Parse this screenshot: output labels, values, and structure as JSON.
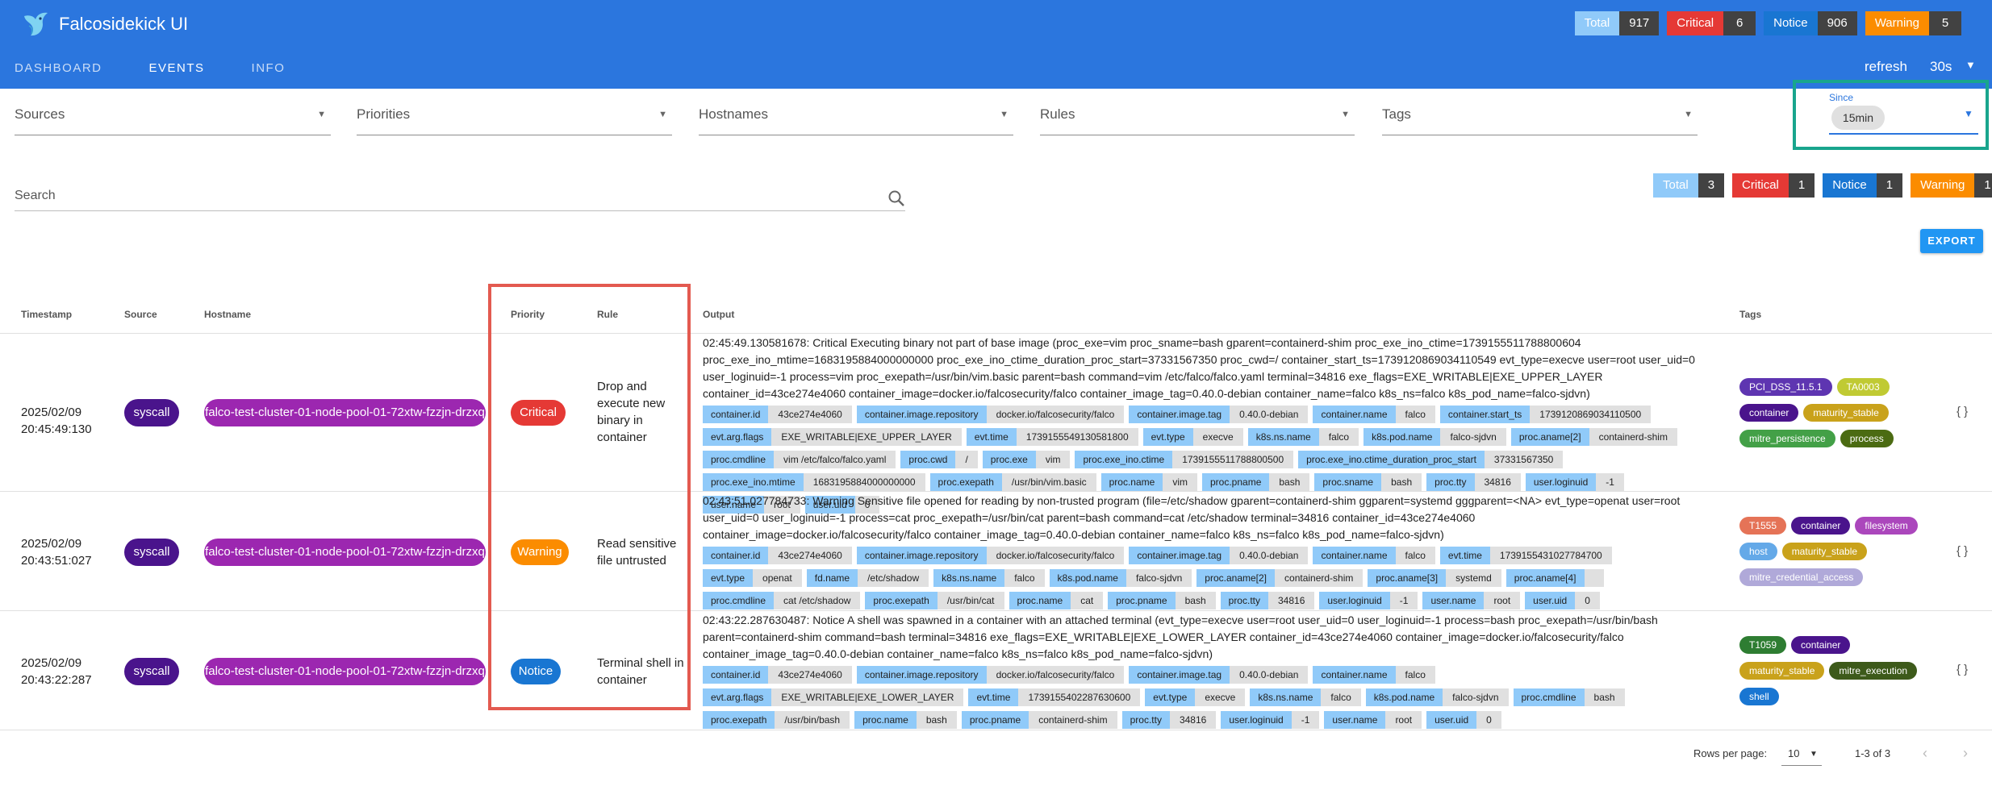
{
  "app": {
    "title": "Falcosidekick UI"
  },
  "header_counts": [
    {
      "label": "Total",
      "count": "917",
      "color": "#90caf9"
    },
    {
      "label": "Critical",
      "count": "6",
      "color": "#e53935"
    },
    {
      "label": "Notice",
      "count": "906",
      "color": "#1976d2"
    },
    {
      "label": "Warning",
      "count": "5",
      "color": "#fb8c00"
    }
  ],
  "nav": {
    "dashboard": "DASHBOARD",
    "events": "EVENTS",
    "info": "INFO"
  },
  "refresh": {
    "label": "refresh",
    "value": "30s"
  },
  "filters": {
    "sources": "Sources",
    "priorities": "Priorities",
    "hostnames": "Hostnames",
    "rules": "Rules",
    "tags": "Tags"
  },
  "since": {
    "label": "Since",
    "value": "15min"
  },
  "search": {
    "placeholder": "Search"
  },
  "summary_counts": [
    {
      "label": "Total",
      "count": "3",
      "color": "#90caf9"
    },
    {
      "label": "Critical",
      "count": "1",
      "color": "#e53935"
    },
    {
      "label": "Notice",
      "count": "1",
      "color": "#1976d2"
    },
    {
      "label": "Warning",
      "count": "1",
      "color": "#fb8c00"
    }
  ],
  "export_label": "EXPORT",
  "columns": {
    "timestamp": "Timestamp",
    "source": "Source",
    "hostname": "Hostname",
    "priority": "Priority",
    "rule": "Rule",
    "output": "Output",
    "tags": "Tags"
  },
  "events": [
    {
      "date": "2025/02/09",
      "time": "20:45:49:130",
      "source": "syscall",
      "hostname": "falco-test-cluster-01-node-pool-01-72xtw-fzzjn-drzxq",
      "priority": "Critical",
      "priority_color": "#e53935",
      "rule": "Drop and execute new binary in container",
      "output": "02:45:49.130581678: Critical Executing binary not part of base image (proc_exe=vim proc_sname=bash gparent=containerd-shim proc_exe_ino_ctime=1739155511788800604 proc_exe_ino_mtime=1683195884000000000 proc_exe_ino_ctime_duration_proc_start=37331567350 proc_cwd=/ container_start_ts=1739120869034110549 evt_type=execve user=root user_uid=0 user_loginuid=-1 process=vim proc_exepath=/usr/bin/vim.basic parent=bash command=vim /etc/falco/falco.yaml terminal=34816 exe_flags=EXE_WRITABLE|EXE_UPPER_LAYER container_id=43ce274e4060 container_image=docker.io/falcosecurity/falco container_image_tag=0.40.0-debian container_name=falco k8s_ns=falco k8s_pod_name=falco-sjdvn)",
      "fields": [
        {
          "k": "container.id",
          "v": "43ce274e4060"
        },
        {
          "k": "container.image.repository",
          "v": "docker.io/falcosecurity/falco"
        },
        {
          "k": "container.image.tag",
          "v": "0.40.0-debian"
        },
        {
          "k": "container.name",
          "v": "falco"
        },
        {
          "k": "container.start_ts",
          "v": "1739120869034110500"
        },
        {
          "k": "evt.arg.flags",
          "v": "EXE_WRITABLE|EXE_UPPER_LAYER"
        },
        {
          "k": "evt.time",
          "v": "1739155549130581800"
        },
        {
          "k": "evt.type",
          "v": "execve"
        },
        {
          "k": "k8s.ns.name",
          "v": "falco"
        },
        {
          "k": "k8s.pod.name",
          "v": "falco-sjdvn"
        },
        {
          "k": "proc.aname[2]",
          "v": "containerd-shim"
        },
        {
          "k": "proc.cmdline",
          "v": "vim /etc/falco/falco.yaml"
        },
        {
          "k": "proc.cwd",
          "v": "/"
        },
        {
          "k": "proc.exe",
          "v": "vim"
        },
        {
          "k": "proc.exe_ino.ctime",
          "v": "1739155511788800500"
        },
        {
          "k": "proc.exe_ino.ctime_duration_proc_start",
          "v": "37331567350"
        },
        {
          "k": "proc.exe_ino.mtime",
          "v": "1683195884000000000"
        },
        {
          "k": "proc.exepath",
          "v": "/usr/bin/vim.basic"
        },
        {
          "k": "proc.name",
          "v": "vim"
        },
        {
          "k": "proc.pname",
          "v": "bash"
        },
        {
          "k": "proc.sname",
          "v": "bash"
        },
        {
          "k": "proc.tty",
          "v": "34816"
        },
        {
          "k": "user.loginuid",
          "v": "-1"
        },
        {
          "k": "user.name",
          "v": "root"
        },
        {
          "k": "user.uid",
          "v": "0"
        }
      ],
      "tags": [
        {
          "label": "PCI_DSS_11.5.1",
          "color": "#5e35b1"
        },
        {
          "label": "TA0003",
          "color": "#c0ca33"
        },
        {
          "label": "container",
          "color": "#4a148c"
        },
        {
          "label": "maturity_stable",
          "color": "#c9a21b"
        },
        {
          "label": "mitre_persistence",
          "color": "#43a047"
        },
        {
          "label": "process",
          "color": "#4b6b12"
        }
      ]
    },
    {
      "date": "2025/02/09",
      "time": "20:43:51:027",
      "source": "syscall",
      "hostname": "falco-test-cluster-01-node-pool-01-72xtw-fzzjn-drzxq",
      "priority": "Warning",
      "priority_color": "#fb8c00",
      "rule": "Read sensitive file untrusted",
      "output": "02:43:51.027784733: Warning Sensitive file opened for reading by non-trusted program (file=/etc/shadow gparent=containerd-shim ggparent=systemd gggparent=<NA> evt_type=openat user=root user_uid=0 user_loginuid=-1 process=cat proc_exepath=/usr/bin/cat parent=bash command=cat /etc/shadow terminal=34816 container_id=43ce274e4060 container_image=docker.io/falcosecurity/falco container_image_tag=0.40.0-debian container_name=falco k8s_ns=falco k8s_pod_name=falco-sjdvn)",
      "fields": [
        {
          "k": "container.id",
          "v": "43ce274e4060"
        },
        {
          "k": "container.image.repository",
          "v": "docker.io/falcosecurity/falco"
        },
        {
          "k": "container.image.tag",
          "v": "0.40.0-debian"
        },
        {
          "k": "container.name",
          "v": "falco"
        },
        {
          "k": "evt.time",
          "v": "1739155431027784700"
        },
        {
          "k": "evt.type",
          "v": "openat"
        },
        {
          "k": "fd.name",
          "v": "/etc/shadow"
        },
        {
          "k": "k8s.ns.name",
          "v": "falco"
        },
        {
          "k": "k8s.pod.name",
          "v": "falco-sjdvn"
        },
        {
          "k": "proc.aname[2]",
          "v": "containerd-shim"
        },
        {
          "k": "proc.aname[3]",
          "v": "systemd"
        },
        {
          "k": "proc.aname[4]",
          "v": ""
        },
        {
          "k": "proc.cmdline",
          "v": "cat /etc/shadow"
        },
        {
          "k": "proc.exepath",
          "v": "/usr/bin/cat"
        },
        {
          "k": "proc.name",
          "v": "cat"
        },
        {
          "k": "proc.pname",
          "v": "bash"
        },
        {
          "k": "proc.tty",
          "v": "34816"
        },
        {
          "k": "user.loginuid",
          "v": "-1"
        },
        {
          "k": "user.name",
          "v": "root"
        },
        {
          "k": "user.uid",
          "v": "0"
        }
      ],
      "tags": [
        {
          "label": "T1555",
          "color": "#e57357"
        },
        {
          "label": "container",
          "color": "#4a148c"
        },
        {
          "label": "filesystem",
          "color": "#ab47bc"
        },
        {
          "label": "host",
          "color": "#64a9e8"
        },
        {
          "label": "maturity_stable",
          "color": "#c9a21b"
        },
        {
          "label": "mitre_credential_access",
          "color": "#b0a9d9"
        }
      ]
    },
    {
      "date": "2025/02/09",
      "time": "20:43:22:287",
      "source": "syscall",
      "hostname": "falco-test-cluster-01-node-pool-01-72xtw-fzzjn-drzxq",
      "priority": "Notice",
      "priority_color": "#1976d2",
      "rule": "Terminal shell in container",
      "output": "02:43:22.287630487: Notice A shell was spawned in a container with an attached terminal (evt_type=execve user=root user_uid=0 user_loginuid=-1 process=bash proc_exepath=/usr/bin/bash parent=containerd-shim command=bash terminal=34816 exe_flags=EXE_WRITABLE|EXE_LOWER_LAYER container_id=43ce274e4060 container_image=docker.io/falcosecurity/falco container_image_tag=0.40.0-debian container_name=falco k8s_ns=falco k8s_pod_name=falco-sjdvn)",
      "fields": [
        {
          "k": "container.id",
          "v": "43ce274e4060"
        },
        {
          "k": "container.image.repository",
          "v": "docker.io/falcosecurity/falco"
        },
        {
          "k": "container.image.tag",
          "v": "0.40.0-debian"
        },
        {
          "k": "container.name",
          "v": "falco"
        },
        {
          "k": "evt.arg.flags",
          "v": "EXE_WRITABLE|EXE_LOWER_LAYER"
        },
        {
          "k": "evt.time",
          "v": "1739155402287630600"
        },
        {
          "k": "evt.type",
          "v": "execve"
        },
        {
          "k": "k8s.ns.name",
          "v": "falco"
        },
        {
          "k": "k8s.pod.name",
          "v": "falco-sjdvn"
        },
        {
          "k": "proc.cmdline",
          "v": "bash"
        },
        {
          "k": "proc.exepath",
          "v": "/usr/bin/bash"
        },
        {
          "k": "proc.name",
          "v": "bash"
        },
        {
          "k": "proc.pname",
          "v": "containerd-shim"
        },
        {
          "k": "proc.tty",
          "v": "34816"
        },
        {
          "k": "user.loginuid",
          "v": "-1"
        },
        {
          "k": "user.name",
          "v": "root"
        },
        {
          "k": "user.uid",
          "v": "0"
        }
      ],
      "tags": [
        {
          "label": "T1059",
          "color": "#2e7d32"
        },
        {
          "label": "container",
          "color": "#4a148c"
        },
        {
          "label": "maturity_stable",
          "color": "#c9a21b"
        },
        {
          "label": "mitre_execution",
          "color": "#3d5a1a"
        },
        {
          "label": "shell",
          "color": "#1976d2"
        }
      ]
    }
  ],
  "row_action": "{ }",
  "pagination": {
    "rows_label": "Rows per page:",
    "rows_value": "10",
    "range": "1-3 of 3"
  }
}
